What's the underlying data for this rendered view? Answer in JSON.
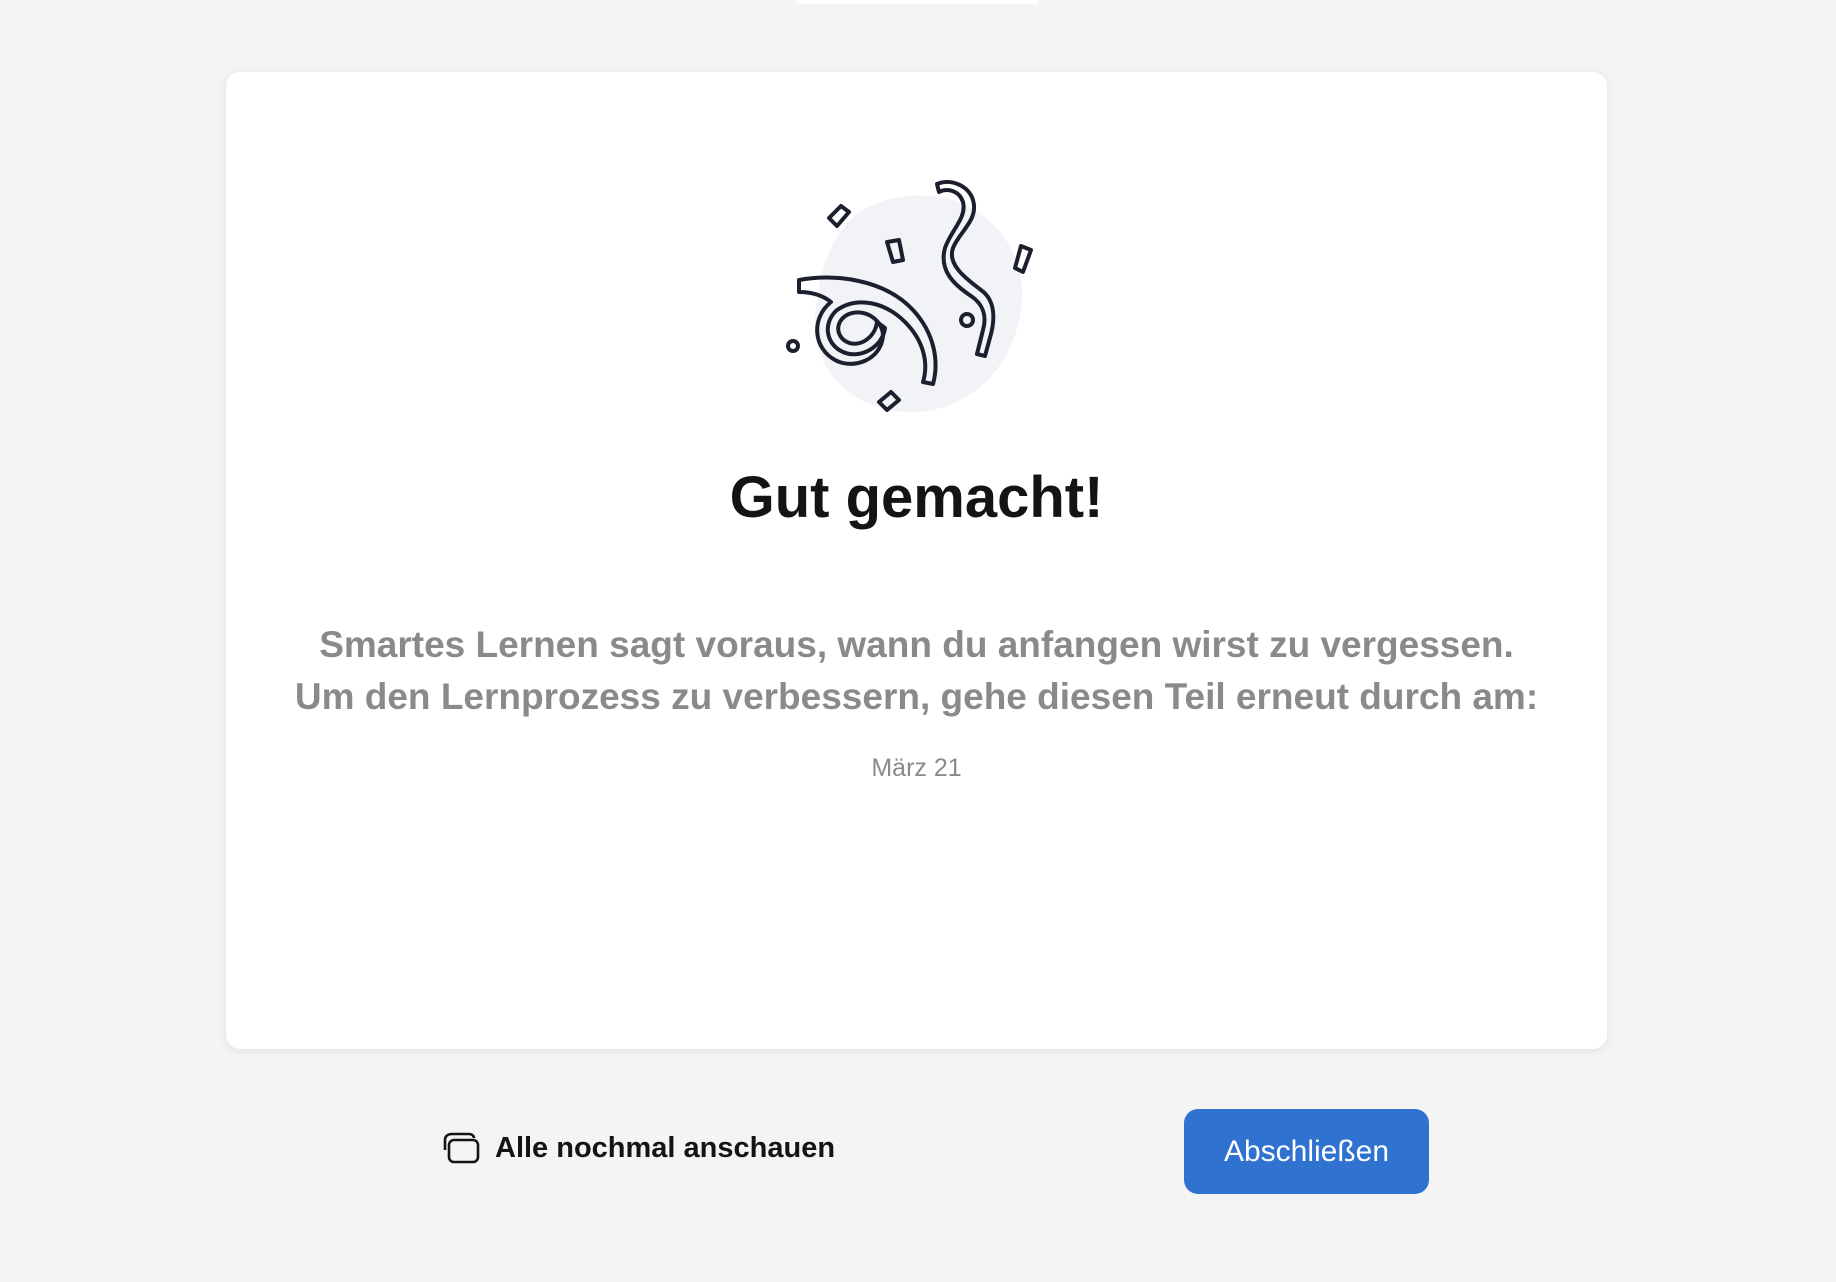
{
  "result": {
    "title": "Gut gemacht!",
    "description_line1": "Smartes Lernen sagt voraus, wann du anfangen wirst zu vergessen.",
    "description_line2": "Um den Lernprozess zu verbessern, gehe diesen Teil erneut durch am:",
    "review_date": "März 21"
  },
  "illustration": {
    "icon": "confetti-icon"
  },
  "actions": {
    "review_all_label": "Alle nochmal anschauen",
    "review_all_icon": "cards-icon",
    "finish_label": "Abschließen"
  },
  "colors": {
    "page_background": "#f4f4f4",
    "card_background": "#ffffff",
    "primary_button": "#2f72cf",
    "title_text": "#141414",
    "secondary_text": "#8a8a8a"
  }
}
